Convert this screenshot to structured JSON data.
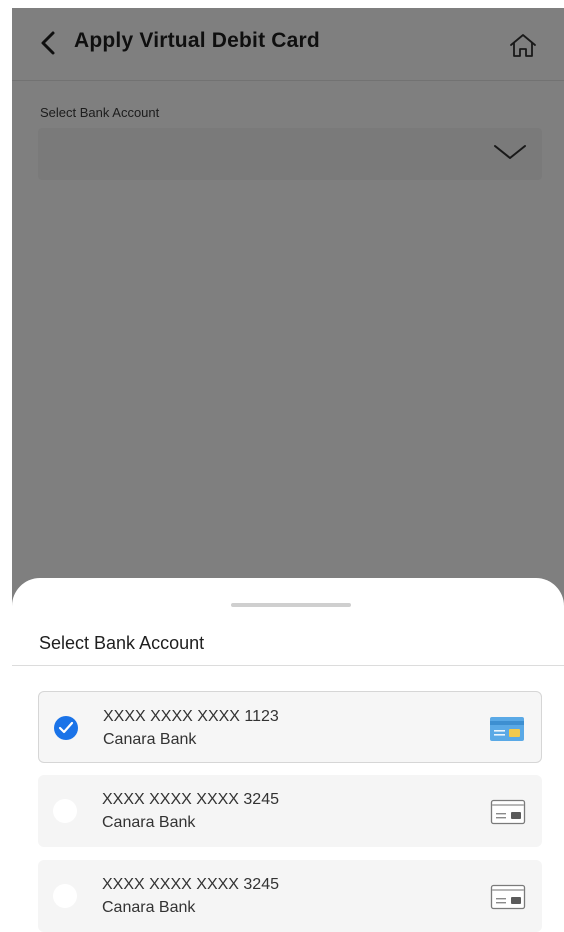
{
  "header": {
    "title": "Apply Virtual Debit Card",
    "back_icon": "chevron-left-icon",
    "home_icon": "home-icon"
  },
  "form": {
    "account_label": "Select Bank Account",
    "account_value": ""
  },
  "sheet": {
    "title": "Select Bank Account",
    "accounts": [
      {
        "number": "XXXX XXXX XXXX 1123",
        "bank": "Canara Bank",
        "selected": true
      },
      {
        "number": "XXXX XXXX XXXX 3245",
        "bank": "Canara Bank",
        "selected": false
      },
      {
        "number": "XXXX XXXX XXXX 3245",
        "bank": "Canara Bank",
        "selected": false
      }
    ]
  },
  "colors": {
    "accent": "#1a73e8",
    "card_active_blue": "#5aa9e6",
    "card_active_chip": "#f2c94c",
    "overlay": "rgba(0,0,0,0.5)"
  }
}
